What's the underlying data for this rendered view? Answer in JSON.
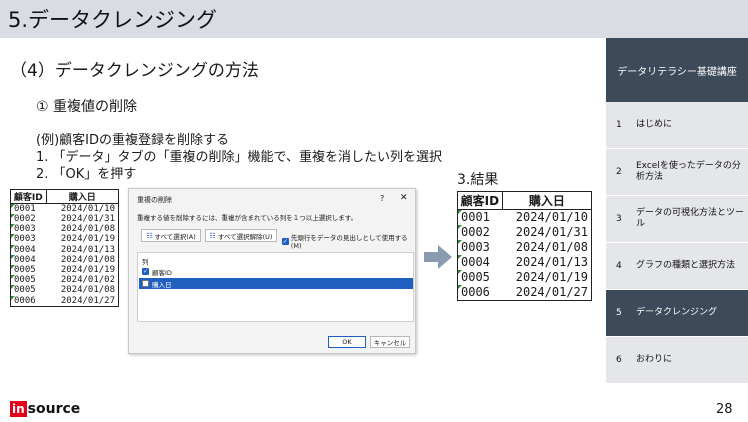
{
  "header": {
    "title": "5.データクレンジング"
  },
  "subtitle": "（4）データクレンジングの方法",
  "point": "① 重複値の削除",
  "example": {
    "line1": "(例)顧客IDの重複登録を削除する",
    "line2": "1. 「データ」タブの「重複の削除」機能で、重複を消したい列を選択",
    "line3": "2. 「OK」を押す"
  },
  "left_table": {
    "headers": [
      "顧客ID",
      "購入日"
    ],
    "rows": [
      [
        "0001",
        "2024/01/10"
      ],
      [
        "0002",
        "2024/01/31"
      ],
      [
        "0003",
        "2024/01/08"
      ],
      [
        "0003",
        "2024/01/19"
      ],
      [
        "0004",
        "2024/01/13"
      ],
      [
        "0004",
        "2024/01/08"
      ],
      [
        "0005",
        "2024/01/19"
      ],
      [
        "0005",
        "2024/01/02"
      ],
      [
        "0005",
        "2024/01/08"
      ],
      [
        "0006",
        "2024/01/27"
      ]
    ]
  },
  "dialog": {
    "title": "重複の削除",
    "help": "?",
    "close": "✕",
    "description": "重複する値を削除するには、重複が含まれている列を１つ以上選択します。",
    "select_all": "すべて選択(A)",
    "unselect_all": "すべて選択解除(U)",
    "header_option": "先頭行をデータの見出しとして使用する(M)",
    "list_header": "列",
    "items": [
      "顧客ID",
      "購入日"
    ],
    "ok": "OK",
    "cancel": "キャンセル"
  },
  "result": {
    "label": "3.結果",
    "headers": [
      "顧客ID",
      "購入日"
    ],
    "rows": [
      [
        "0001",
        "2024/01/10"
      ],
      [
        "0002",
        "2024/01/31"
      ],
      [
        "0003",
        "2024/01/08"
      ],
      [
        "0004",
        "2024/01/13"
      ],
      [
        "0005",
        "2024/01/19"
      ],
      [
        "0006",
        "2024/01/27"
      ]
    ]
  },
  "sidebar": {
    "head": "データリテラシー基礎講座",
    "items": [
      {
        "num": "1",
        "label": "はじめに"
      },
      {
        "num": "2",
        "label": "Excelを使ったデータの分析方法"
      },
      {
        "num": "3",
        "label": "データの可視化方法とツール"
      },
      {
        "num": "4",
        "label": "グラフの種類と選択方法"
      },
      {
        "num": "5",
        "label": "データクレンジング"
      },
      {
        "num": "6",
        "label": "おわりに"
      }
    ]
  },
  "logo": {
    "in": "in",
    "rest": "source"
  },
  "page_number": "28",
  "colors": {
    "header_bg": "#d9dde3",
    "sidebar_dark": "#3c4a5a",
    "sidebar_light": "#e4e6e9",
    "selection": "#1f5fbf",
    "arrow": "#8a9bb0",
    "logo_red": "#e2001a"
  }
}
